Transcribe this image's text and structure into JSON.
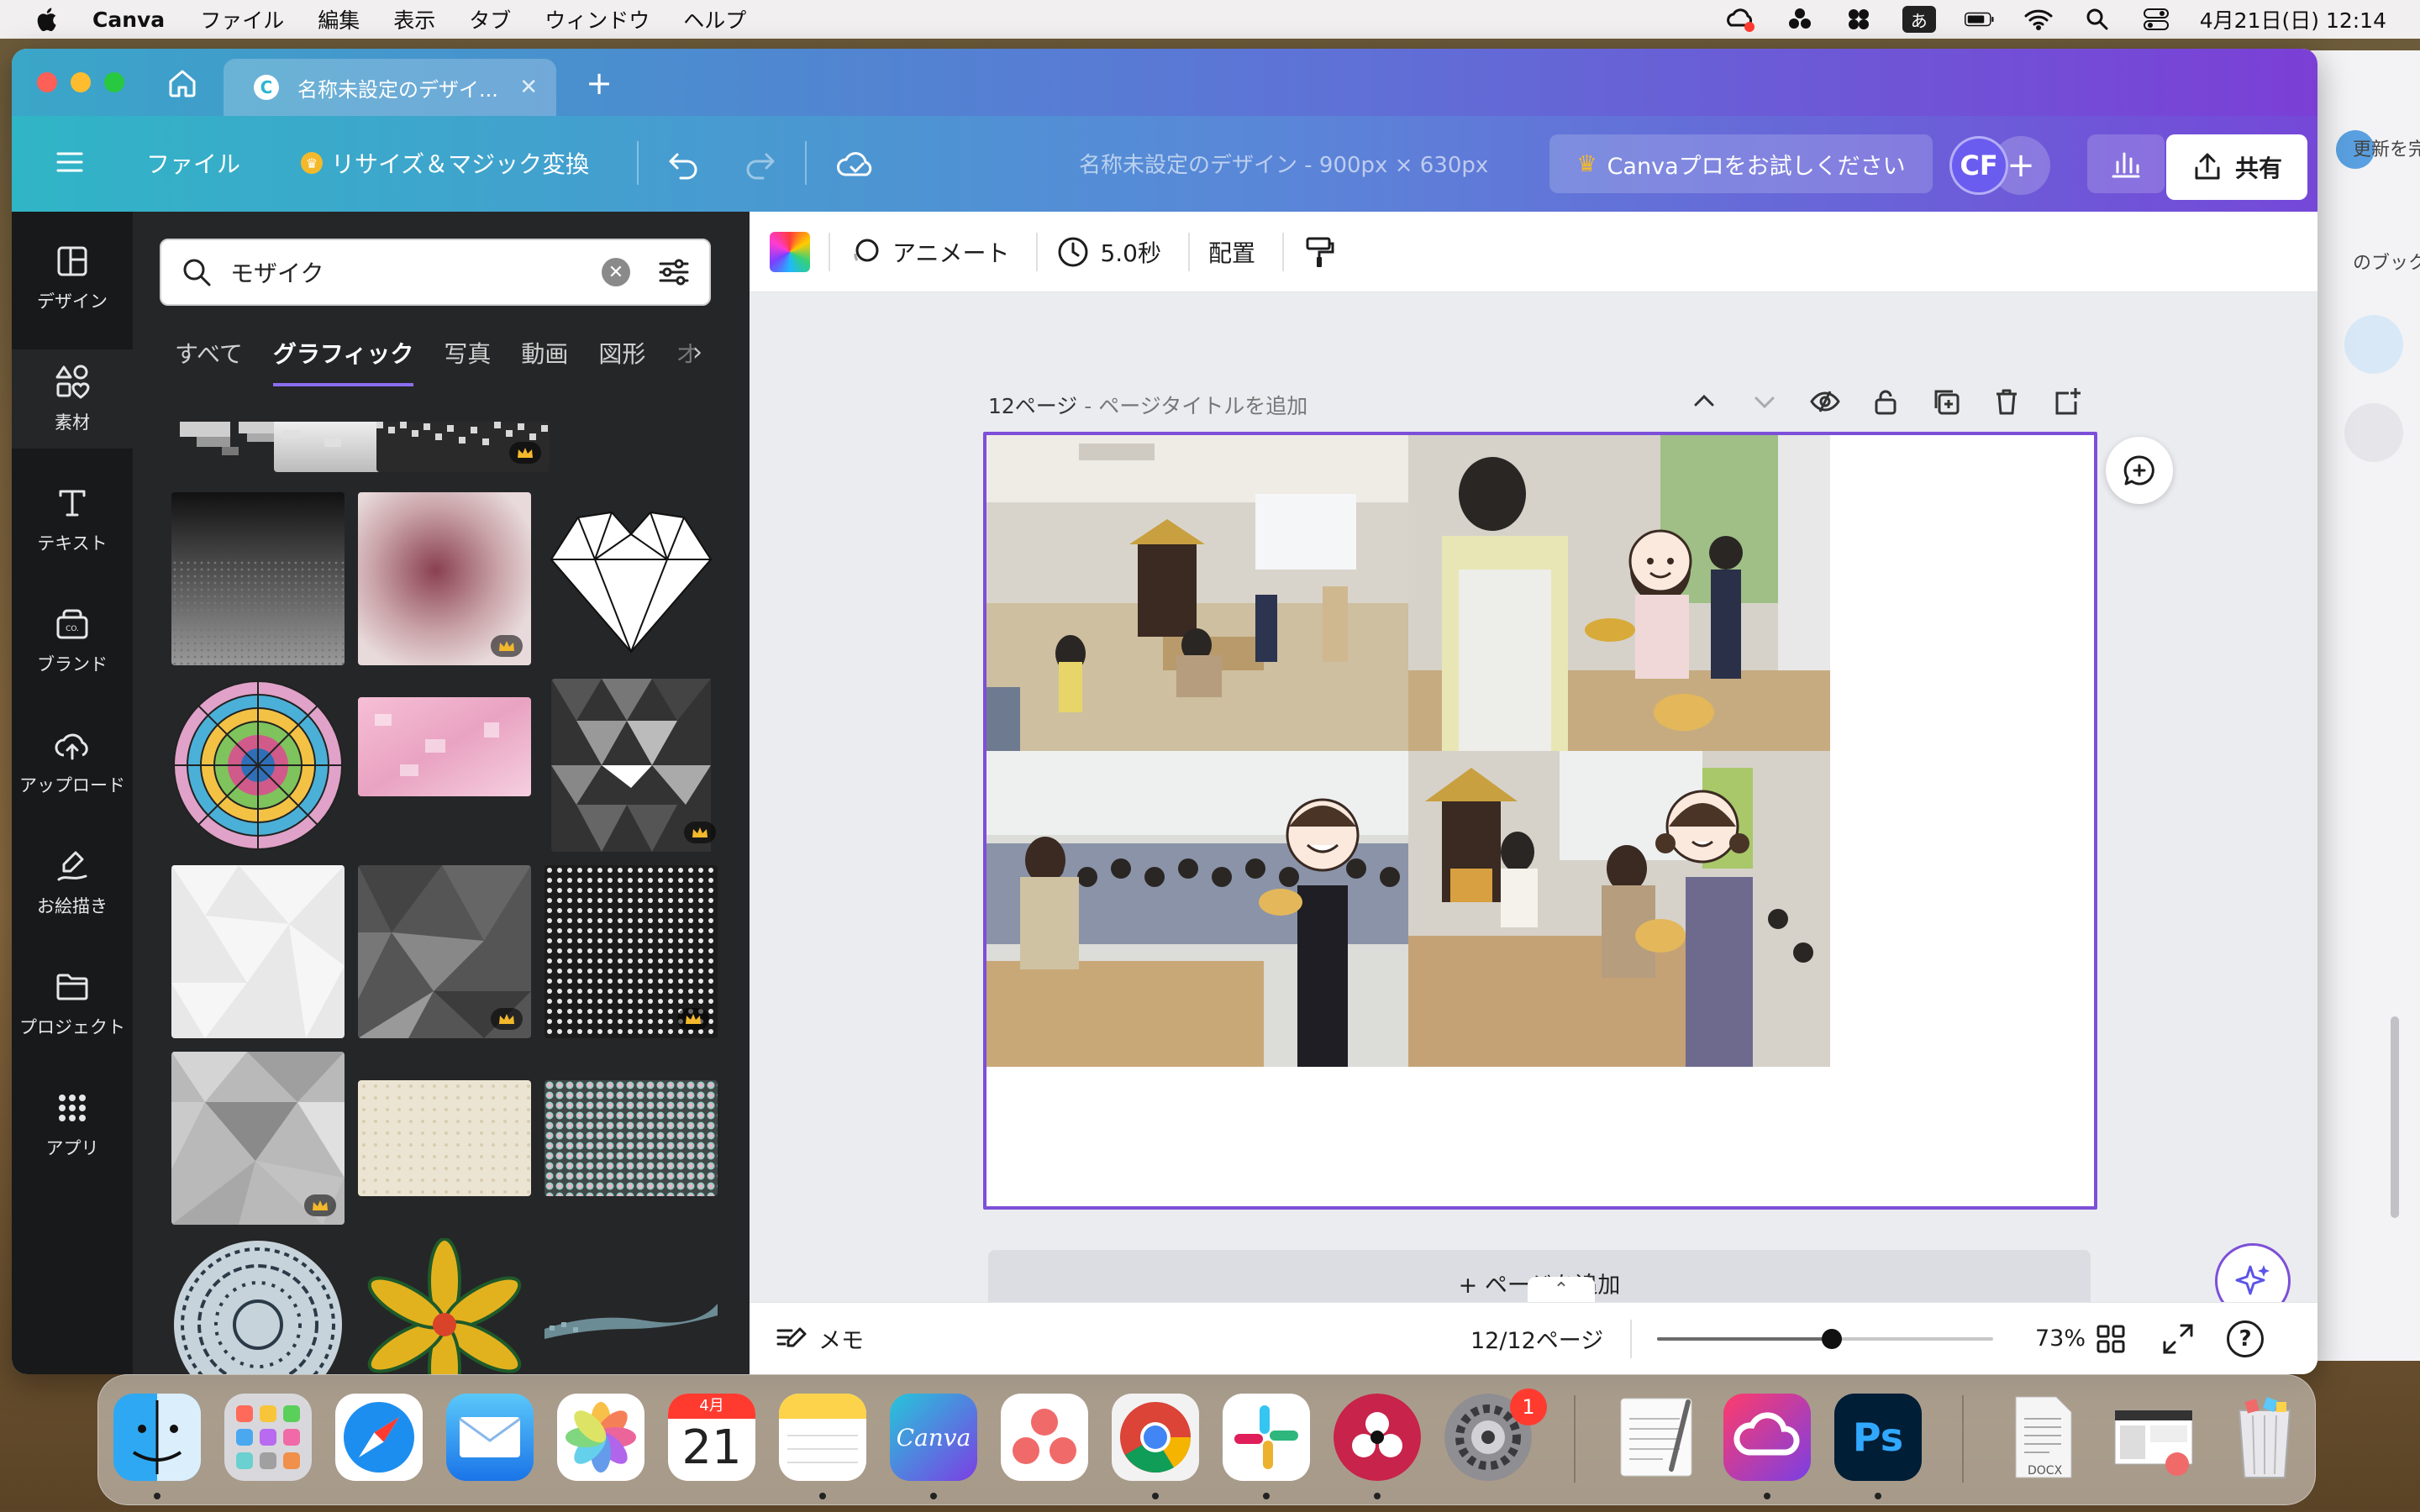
{
  "menubar": {
    "app_name": "Canva",
    "items": [
      "ファイル",
      "編集",
      "表示",
      "タブ",
      "ウィンドウ",
      "ヘルプ"
    ],
    "ime": "あ",
    "datetime": "4月21日(日)  12:14"
  },
  "background_window": {
    "text1": "更新を完",
    "text2": "のブック"
  },
  "browser": {
    "tab_title": "名称未設定のデザイ...",
    "tab_icon": "C"
  },
  "toolbar": {
    "file_label": "ファイル",
    "resize_label": "リサイズ＆マジック変換",
    "doc_title": "名称未設定のデザイン - 900px × 630px",
    "pro_label": "Canvaプロをお試しください",
    "avatar_initials": "CF",
    "share_label": "共有"
  },
  "rail": {
    "items": [
      {
        "label": "デザイン",
        "icon": "layout-icon"
      },
      {
        "label": "素材",
        "icon": "elements-icon"
      },
      {
        "label": "テキスト",
        "icon": "text-icon"
      },
      {
        "label": "ブランド",
        "icon": "brand-icon"
      },
      {
        "label": "アップロード",
        "icon": "upload-icon"
      },
      {
        "label": "お絵描き",
        "icon": "draw-icon"
      },
      {
        "label": "プロジェクト",
        "icon": "folder-icon"
      },
      {
        "label": "アプリ",
        "icon": "apps-icon"
      }
    ],
    "active_index": 1
  },
  "panel": {
    "search_value": "モザイク",
    "categories": [
      "すべて",
      "グラフィック",
      "写真",
      "動画",
      "図形",
      "オ"
    ],
    "active_category": 1
  },
  "context_bar": {
    "animate_label": "アニメート",
    "duration_label": "5.0秒",
    "position_label": "配置"
  },
  "page": {
    "number_label": "12ページ",
    "title_placeholder": " - ページタイトルを追加"
  },
  "add_page_label": "+ ページを追加",
  "footer": {
    "notes_label": "メモ",
    "page_counter": "12/12ページ",
    "zoom_label": "73%",
    "zoom_fraction": 0.52,
    "help_label": "?"
  },
  "dock": {
    "calendar_month": "4月",
    "calendar_day": "21",
    "canva_label": "Canva",
    "settings_badge": "1",
    "photoshop_label": "Ps",
    "docx_label": "DOCX"
  },
  "colors": {
    "accent_purple": "#7d4fd8",
    "canva_teal": "#30b5c6",
    "pro_crown": "#f4b92b"
  }
}
